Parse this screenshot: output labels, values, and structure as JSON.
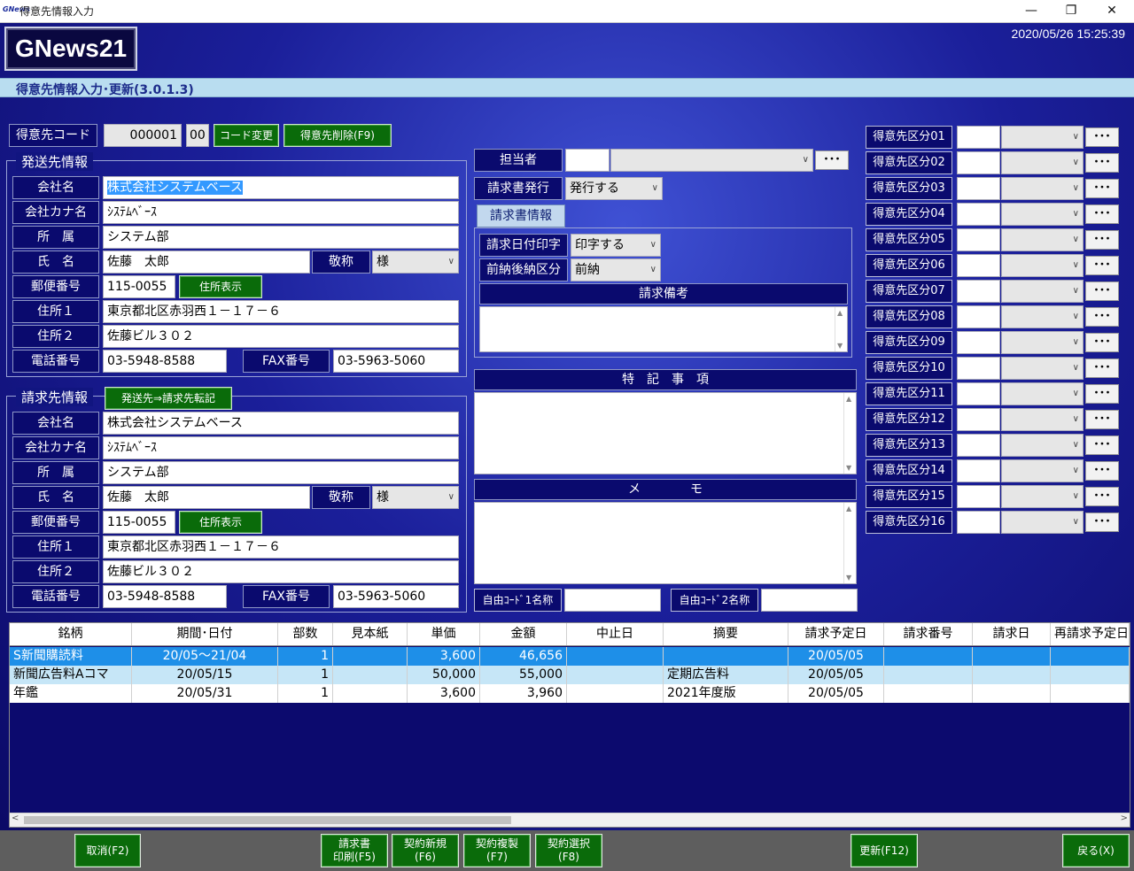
{
  "window": {
    "title": "得意先情報入力",
    "icon_text": "GNews",
    "min": "—",
    "max": "❐",
    "close": "✕"
  },
  "header": {
    "logo": "GNews21",
    "datetime": "2020/05/26 15:25:39",
    "subtitle": "得意先情報入力･更新(3.0.1.3)"
  },
  "customer": {
    "code_label": "得意先コード",
    "code": "000001",
    "branch": "00",
    "change_code": "コード変更",
    "delete": "得意先削除(F9)"
  },
  "shipping": {
    "title": "発送先情報",
    "company_label": "会社名",
    "company": "株式会社システムベース",
    "kana_label": "会社カナ名",
    "kana": "ｼｽﾃﾑﾍﾞｰｽ",
    "dept_label": "所　属",
    "dept": "システム部",
    "name_label": "氏　名",
    "name": "佐藤　太郎",
    "honorific_label": "敬称",
    "honorific": "様",
    "zip_label": "郵便番号",
    "zip": "115-0055",
    "addr_btn": "住所表示",
    "addr1_label": "住所１",
    "addr1": "東京都北区赤羽西１－１７－６",
    "addr2_label": "住所２",
    "addr2": "佐藤ビル３０２",
    "tel_label": "電話番号",
    "tel": "03-5948-8588",
    "fax_label": "FAX番号",
    "fax": "03-5963-5060"
  },
  "billing": {
    "title": "請求先情報",
    "copy_btn": "発送先⇒請求先転記",
    "company_label": "会社名",
    "company": "株式会社システムベース",
    "kana_label": "会社カナ名",
    "kana": "ｼｽﾃﾑﾍﾞｰｽ",
    "dept_label": "所　属",
    "dept": "システム部",
    "name_label": "氏　名",
    "name": "佐藤　太郎",
    "honorific_label": "敬称",
    "honorific": "様",
    "zip_label": "郵便番号",
    "zip": "115-0055",
    "addr_btn": "住所表示",
    "addr1_label": "住所１",
    "addr1": "東京都北区赤羽西１－１７－６",
    "addr2_label": "住所２",
    "addr2": "佐藤ビル３０２",
    "tel_label": "電話番号",
    "tel": "03-5948-8588",
    "fax_label": "FAX番号",
    "fax": "03-5963-5060"
  },
  "middle": {
    "staff_label": "担当者",
    "invoice_issue_label": "請求書発行",
    "invoice_issue": "発行する",
    "invoice_info_tab": "請求書情報",
    "invoice_date_print_label": "請求日付印字",
    "invoice_date_print": "印字する",
    "prepay_label": "前納後納区分",
    "prepay": "前納",
    "invoice_note_label": "請求備考",
    "special_notes_label": "特　記　事　項",
    "memo_label": "メ　　　　モ",
    "free1_label": "自由ｺｰﾄﾞ1名称",
    "free2_label": "自由ｺｰﾄﾞ2名称",
    "dots": "･･･"
  },
  "categories": [
    "得意先区分01",
    "得意先区分02",
    "得意先区分03",
    "得意先区分04",
    "得意先区分05",
    "得意先区分06",
    "得意先区分07",
    "得意先区分08",
    "得意先区分09",
    "得意先区分10",
    "得意先区分11",
    "得意先区分12",
    "得意先区分13",
    "得意先区分14",
    "得意先区分15",
    "得意先区分16"
  ],
  "grid": {
    "headers": [
      "銘柄",
      "期間･日付",
      "部数",
      "見本紙",
      "単価",
      "金額",
      "中止日",
      "摘要",
      "請求予定日",
      "請求番号",
      "請求日",
      "再請求予定日"
    ],
    "rows": [
      [
        "S新聞購読料",
        "20/05～21/04",
        "1",
        "",
        "3,600",
        "46,656",
        "",
        "",
        "20/05/05",
        "",
        "",
        ""
      ],
      [
        "新聞広告料Aコマ",
        "20/05/15",
        "1",
        "",
        "50,000",
        "55,000",
        "",
        "定期広告料",
        "20/05/05",
        "",
        "",
        ""
      ],
      [
        "年鑑",
        "20/05/31",
        "1",
        "",
        "3,600",
        "3,960",
        "",
        "2021年度版",
        "20/05/05",
        "",
        "",
        ""
      ]
    ]
  },
  "footer": {
    "cancel": "取消(F2)",
    "print_invoice": "請求書\n印刷(F5)",
    "contract_new": "契約新規\n(F6)",
    "contract_copy": "契約複製\n(F7)",
    "contract_select": "契約選択\n(F8)",
    "update": "更新(F12)",
    "back": "戻る(X)"
  }
}
